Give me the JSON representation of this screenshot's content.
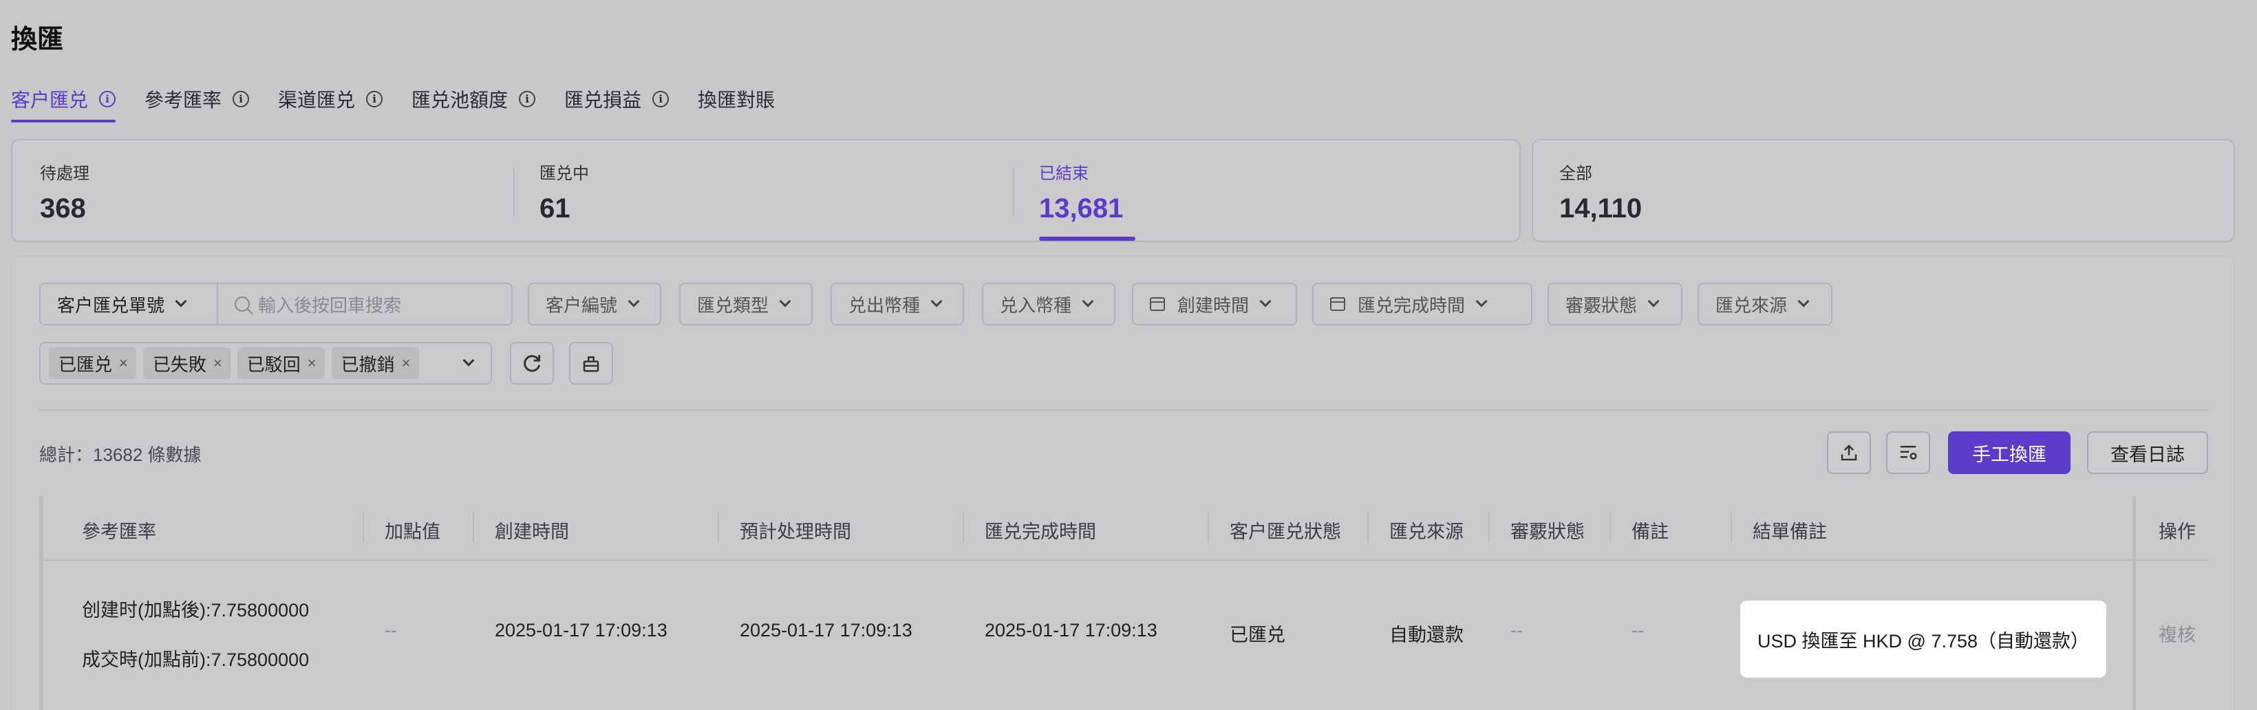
{
  "page": {
    "title": "換匯"
  },
  "tabs": [
    {
      "label": "客户匯兑",
      "info": "i"
    },
    {
      "label": "參考匯率",
      "info": "i"
    },
    {
      "label": "渠道匯兑",
      "info": "i"
    },
    {
      "label": "匯兑池額度",
      "info": "i"
    },
    {
      "label": "匯兑損益",
      "info": "i"
    },
    {
      "label": "換匯對賬"
    }
  ],
  "stats": [
    {
      "label": "待處理",
      "value": "368"
    },
    {
      "label": "匯兑中",
      "value": "61"
    },
    {
      "label": "已結束",
      "value": "13,681"
    },
    {
      "label": "全部",
      "value": "14,110"
    }
  ],
  "filters": {
    "order_select": "客户匯兑單號",
    "search_placeholder": "輸入後按回車搜索",
    "customer_no": "客户編號",
    "exchange_type": "匯兑類型",
    "sell_currency": "兑出幣種",
    "buy_currency": "兑入幣種",
    "created_time": "創建時間",
    "completed_time": "匯兑完成時間",
    "review_status": "審覈狀態",
    "source": "匯兑來源",
    "status_tags": [
      "已匯兑",
      "已失敗",
      "已駁回",
      "已撤銷"
    ],
    "tag_close": "×"
  },
  "summary": {
    "total": "總計：13682 條數據"
  },
  "actions": {
    "manual_exchange": "手工換匯",
    "view_log": "查看日誌"
  },
  "table": {
    "columns": {
      "ref_rate": "參考匯率",
      "markup": "加點值",
      "created": "創建時間",
      "expected": "預計处理時間",
      "completed": "匯兑完成時間",
      "status": "客户匯兑狀態",
      "source": "匯兑來源",
      "review": "審覈狀態",
      "remark": "備註",
      "close_remark": "結單備註",
      "ops": "操作"
    },
    "row": {
      "rate_created": "创建时(加點後):7.75800000",
      "rate_deal": "成交時(加點前):7.75800000",
      "markup": "--",
      "created": "2025-01-17 17:09:13",
      "expected": "2025-01-17 17:09:13",
      "completed": "2025-01-17 17:09:13",
      "status": "已匯兑",
      "source": "自動還款",
      "review": "--",
      "remark": "--",
      "close_remark": "USD 換匯至 HKD @ 7.758（自動還款）",
      "op": "複核"
    }
  },
  "colors": {
    "accent": "#5a3cc8"
  }
}
